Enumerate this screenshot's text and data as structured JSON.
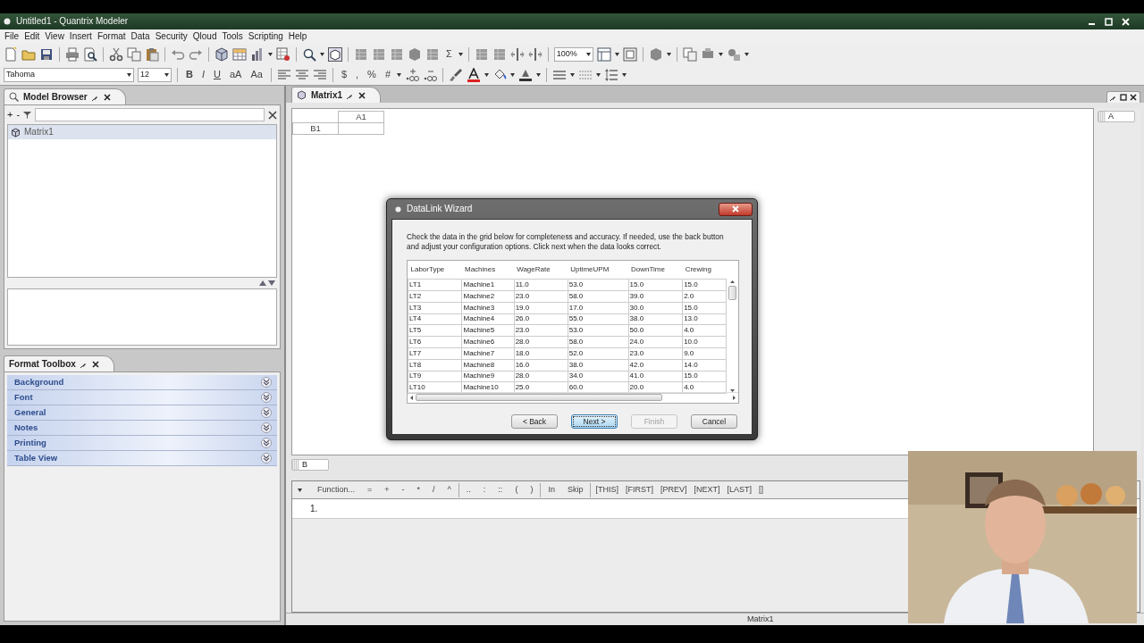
{
  "window": {
    "title": "Untitled1 - Quantrix Modeler"
  },
  "menu": [
    "File",
    "Edit",
    "View",
    "Insert",
    "Format",
    "Data",
    "Security",
    "Qloud",
    "Tools",
    "Scripting",
    "Help"
  ],
  "toolbar": {
    "sum": "Σ",
    "zoom": "100%"
  },
  "format_bar": {
    "font": "Tahoma",
    "size": "12",
    "style_buttons": [
      "B",
      "I",
      "U"
    ],
    "size_buttons": [
      "aA",
      "Aa"
    ],
    "number_buttons": [
      "$",
      ",",
      "%",
      "#"
    ]
  },
  "model_browser": {
    "title": "Model Browser",
    "filter_buttons": [
      "+",
      "-"
    ],
    "tree": [
      {
        "label": "Matrix1",
        "selected": true
      }
    ]
  },
  "format_toolbox": {
    "title": "Format Toolbox",
    "sections": [
      {
        "label": "Background",
        "expanded": false
      },
      {
        "label": "Font",
        "expanded": false
      },
      {
        "label": "General",
        "expanded": false
      },
      {
        "label": "Notes",
        "expanded": false
      },
      {
        "label": "Printing",
        "expanded": false
      },
      {
        "label": "Table View",
        "expanded": false
      }
    ]
  },
  "editor_tab": {
    "title": "Matrix1"
  },
  "grid": {
    "column_header": "A1",
    "row_header": "B1"
  },
  "category_tiles": {
    "row": "B",
    "column": "A"
  },
  "formula_bar": {
    "function_label": "Function...",
    "groups": [
      [
        "=",
        "+",
        "-",
        "*",
        "/",
        "^"
      ],
      [
        "..",
        ":",
        "::",
        "(",
        ")"
      ],
      [
        "In",
        "Skip"
      ],
      [
        "[THIS]",
        "[FIRST]",
        "[PREV]",
        "[NEXT]",
        "[LAST]",
        "[]"
      ]
    ]
  },
  "formula_lines": [
    "1."
  ],
  "status_bar": {
    "text": "Matrix1"
  },
  "dialog": {
    "title": "DataLink Wizard",
    "instructions": "Check the data in the grid below for completeness and accuracy.  If needed, use the back button and adjust your configuration options.  Click next when the data looks correct.",
    "table": {
      "columns": [
        "LaborType",
        "Machines",
        "WageRate",
        "UptimeUPM",
        "DownTime",
        "Crewing"
      ],
      "rows": [
        [
          "LT1",
          "Machine1",
          "11.0",
          "53.0",
          "15.0",
          "15.0"
        ],
        [
          "LT2",
          "Machine2",
          "23.0",
          "58.0",
          "39.0",
          "2.0"
        ],
        [
          "LT3",
          "Machine3",
          "19.0",
          "17.0",
          "30.0",
          "15.0"
        ],
        [
          "LT4",
          "Machine4",
          "26.0",
          "55.0",
          "38.0",
          "13.0"
        ],
        [
          "LT5",
          "Machine5",
          "23.0",
          "53.0",
          "50.0",
          "4.0"
        ],
        [
          "LT6",
          "Machine6",
          "28.0",
          "58.0",
          "24.0",
          "10.0"
        ],
        [
          "LT7",
          "Machine7",
          "18.0",
          "52.0",
          "23.0",
          "9.0"
        ],
        [
          "LT8",
          "Machine8",
          "16.0",
          "38.0",
          "42.0",
          "14.0"
        ],
        [
          "LT9",
          "Machine9",
          "28.0",
          "34.0",
          "41.0",
          "15.0"
        ],
        [
          "LT10",
          "Machine10",
          "25.0",
          "60.0",
          "20.0",
          "4.0"
        ]
      ]
    },
    "buttons": [
      {
        "label": "< Back",
        "disabled": false,
        "focused": false
      },
      {
        "label": "Next >",
        "disabled": false,
        "focused": true
      },
      {
        "label": "Finish",
        "disabled": true,
        "focused": false
      },
      {
        "label": "Cancel",
        "disabled": false,
        "focused": false
      }
    ]
  },
  "webcam": {
    "kind": "picture"
  }
}
